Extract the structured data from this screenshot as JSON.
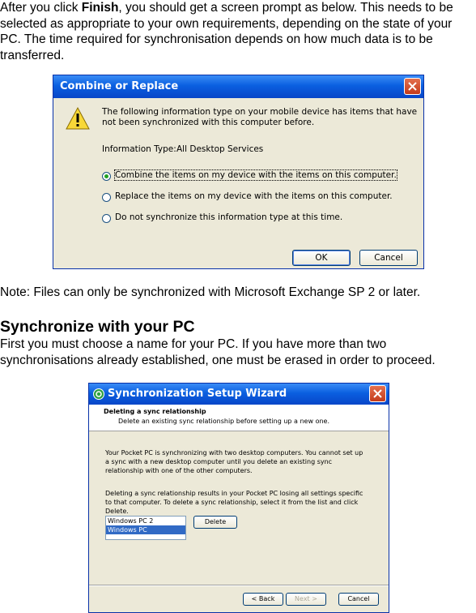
{
  "intro": {
    "text_before": "After you click ",
    "bold": "Finish",
    "text_after": ", you should get a screen prompt as below. This needs to be selected as appropriate to your own requirements, depending on the state of your PC. The time required for synchronisation depends on how much data is to be transferred."
  },
  "dialog1": {
    "title": "Combine or Replace",
    "message": "The following information type on your mobile device has items that have not been synchronized with this computer before.",
    "info_label": "Information Type:",
    "info_value": "All Desktop Services",
    "options": [
      "Combine the items on my device with the items on this computer.",
      "Replace the items on my device with the items on this computer.",
      "Do not synchronize this information type at this time."
    ],
    "selected_option": 0,
    "ok_label": "OK",
    "cancel_label": "Cancel"
  },
  "note": "Note: Files can only be synchronized with Microsoft Exchange SP 2 or later.",
  "section": {
    "heading": "Synchronize with your PC",
    "body": "First you must choose a name for your PC. If you have more than two synchronisations already established, one must be erased in order to proceed."
  },
  "dialog2": {
    "title": "Synchronization Setup Wizard",
    "header_title": "Deleting a sync relationship",
    "header_subtitle": "Delete an existing sync relationship before setting up a new one.",
    "body1": "Your Pocket PC is synchronizing with two desktop computers. You cannot set up a sync with a new desktop computer until you delete an existing sync relationship with one of the other computers.",
    "body2": "Deleting a sync relationship results in your Pocket PC losing all settings specific to that computer. To delete a sync relationship, select it from the list and click Delete.",
    "list": [
      "Windows PC 2",
      "Windows PC"
    ],
    "selected_list_index": 1,
    "delete_label": "Delete",
    "back_label": "< Back",
    "next_label": "Next >",
    "cancel_label": "Cancel"
  },
  "colors": {
    "titlebar": "#0a5fe0",
    "dialog_bg": "#ece9d8",
    "selection": "#316ac5"
  }
}
